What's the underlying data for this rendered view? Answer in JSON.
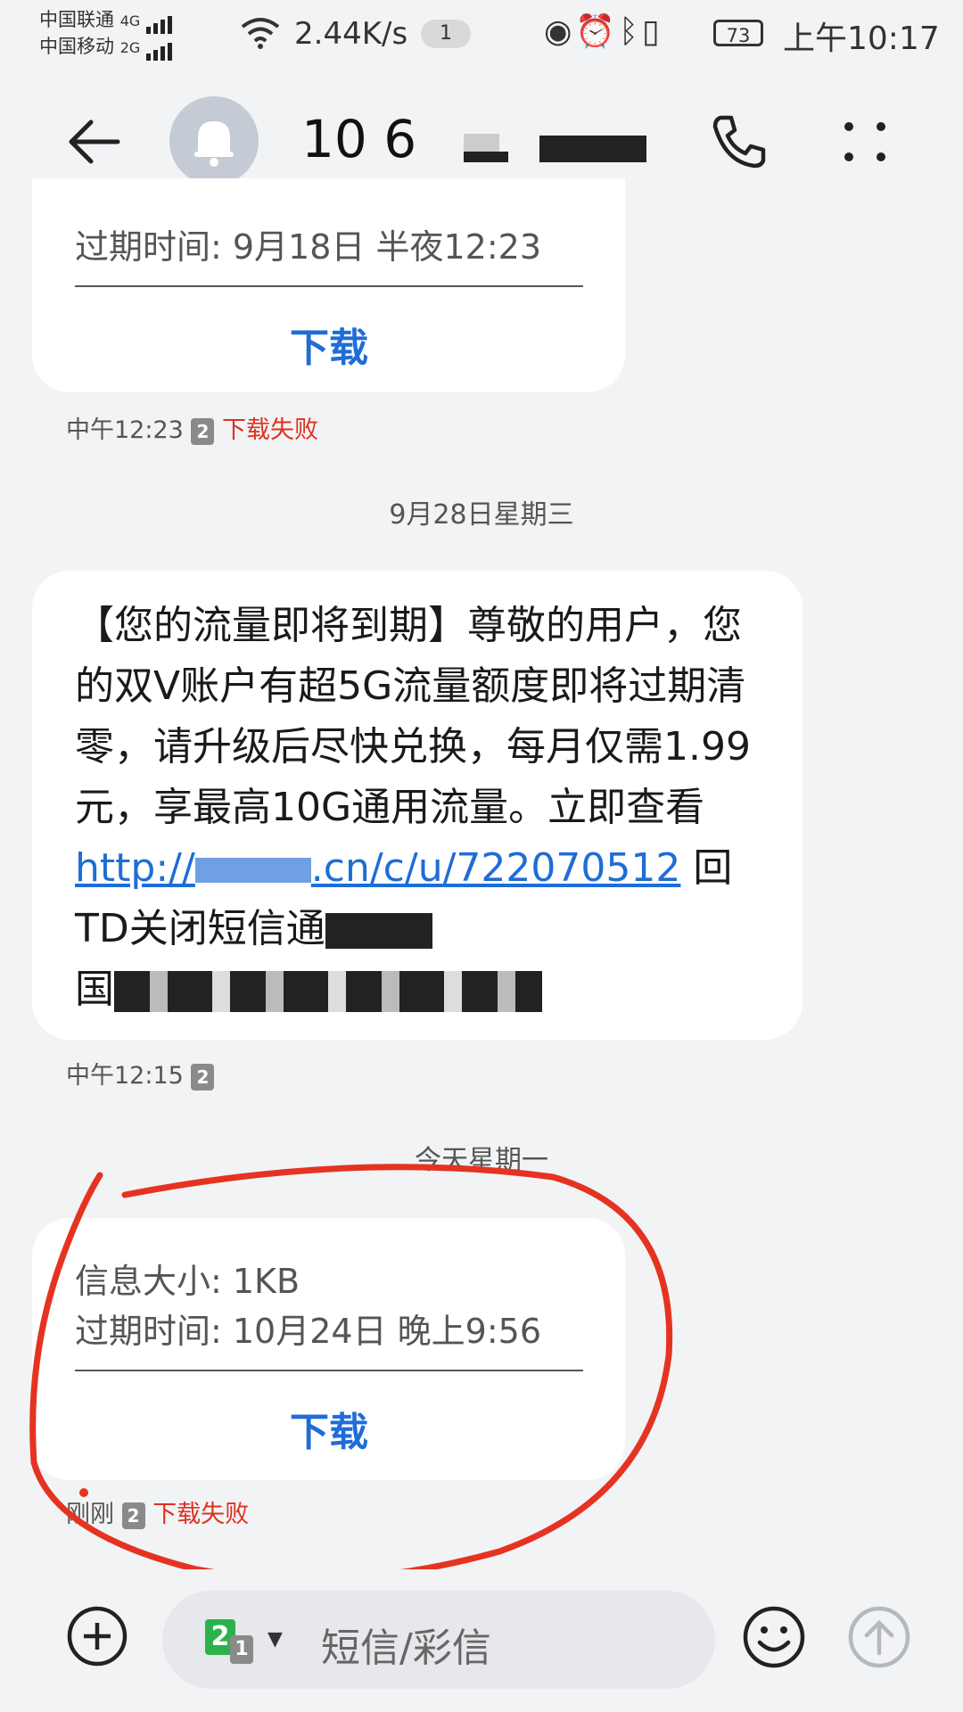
{
  "status_bar": {
    "carrier_1": "中国联通",
    "carrier_2": "中国移动",
    "net_1": "4G",
    "net_2": "2G",
    "speed": "2.44K/s",
    "notif_count": "1",
    "battery": "73",
    "time": "上午10:17"
  },
  "header": {
    "contact_number_visible": "10 6"
  },
  "messages": {
    "mms_1": {
      "expiry": "过期时间:  9月18日 半夜12:23",
      "download_label": "下载",
      "time": "中午12:23",
      "sim": "2",
      "status": "下载失败"
    },
    "date_sep_1": "9月28日星期三",
    "sms_2": {
      "text_plain": "【您的流量即将到期】尊敬的用户，您的双V账户有超5G流量额度即将过期清零，请升级后尽快兑换，每月仅需1.99元，享最高10G通用流量。立即查看",
      "link_part_1": "http://",
      "link_part_2": ".cn/c/u",
      "link_part_3": "/722070512",
      "tail": " 回TD关闭短信通",
      "tail_2": "国",
      "time": "中午12:15",
      "sim": "2"
    },
    "date_sep_2": "今天星期一",
    "mms_3": {
      "size": "信息大小:  1KB",
      "expiry": "过期时间:  10月24日 晚上9:56",
      "download_label": "下载",
      "time": "刚刚",
      "sim": "2",
      "status": "下载失败"
    }
  },
  "input_bar": {
    "placeholder": "短信/彩信",
    "sim_main": "2",
    "sim_sub": "1"
  },
  "colors": {
    "link_blue": "#1f6dd6",
    "fail_red": "#e0301e",
    "annotation_red": "#e53322",
    "background": "#f1f3f5"
  }
}
